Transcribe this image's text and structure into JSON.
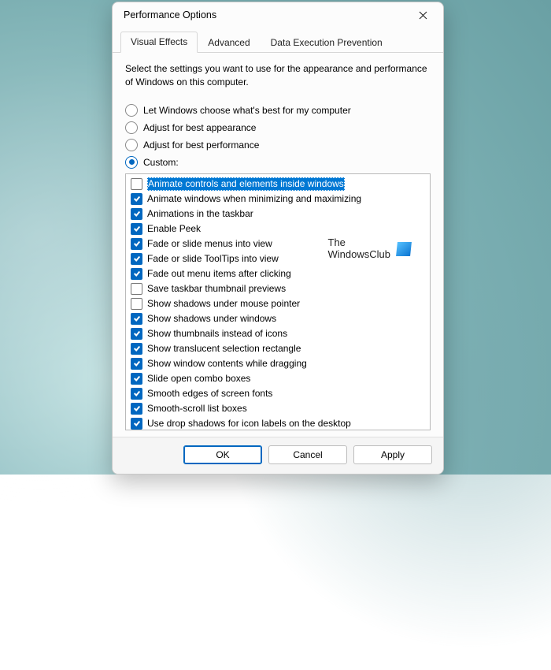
{
  "window": {
    "title": "Performance Options"
  },
  "tabs": [
    {
      "label": "Visual Effects",
      "active": true
    },
    {
      "label": "Advanced",
      "active": false
    },
    {
      "label": "Data Execution Prevention",
      "active": false
    }
  ],
  "instruction": "Select the settings you want to use for the appearance and performance of Windows on this computer.",
  "radios": [
    {
      "label": "Let Windows choose what's best for my computer",
      "selected": false
    },
    {
      "label": "Adjust for best appearance",
      "selected": false
    },
    {
      "label": "Adjust for best performance",
      "selected": false
    },
    {
      "label": "Custom:",
      "selected": true
    }
  ],
  "options": [
    {
      "label": "Animate controls and elements inside windows",
      "checked": false,
      "highlight": true
    },
    {
      "label": "Animate windows when minimizing and maximizing",
      "checked": true
    },
    {
      "label": "Animations in the taskbar",
      "checked": true
    },
    {
      "label": "Enable Peek",
      "checked": true
    },
    {
      "label": "Fade or slide menus into view",
      "checked": true
    },
    {
      "label": "Fade or slide ToolTips into view",
      "checked": true
    },
    {
      "label": "Fade out menu items after clicking",
      "checked": true
    },
    {
      "label": "Save taskbar thumbnail previews",
      "checked": false
    },
    {
      "label": "Show shadows under mouse pointer",
      "checked": false
    },
    {
      "label": "Show shadows under windows",
      "checked": true
    },
    {
      "label": "Show thumbnails instead of icons",
      "checked": true
    },
    {
      "label": "Show translucent selection rectangle",
      "checked": true
    },
    {
      "label": "Show window contents while dragging",
      "checked": true
    },
    {
      "label": "Slide open combo boxes",
      "checked": true
    },
    {
      "label": "Smooth edges of screen fonts",
      "checked": true
    },
    {
      "label": "Smooth-scroll list boxes",
      "checked": true
    },
    {
      "label": "Use drop shadows for icon labels on the desktop",
      "checked": true
    }
  ],
  "watermark": {
    "line1": "The",
    "line2": "WindowsClub"
  },
  "buttons": {
    "ok": "OK",
    "cancel": "Cancel",
    "apply": "Apply"
  }
}
